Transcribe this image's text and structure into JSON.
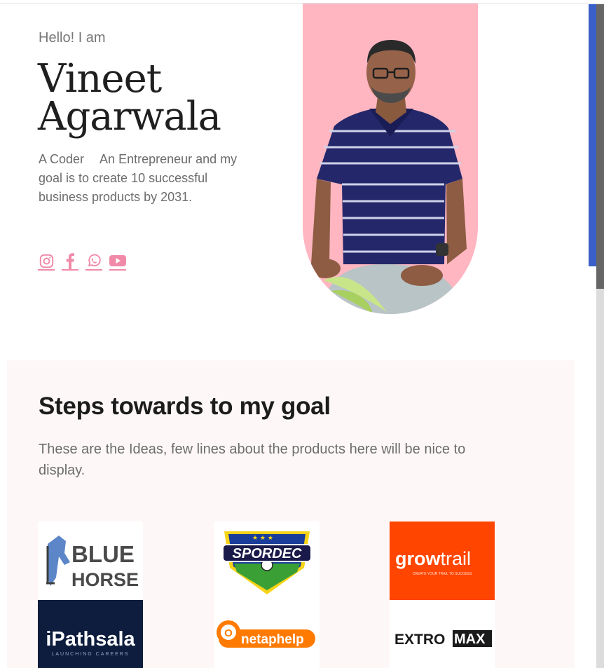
{
  "hero": {
    "greeting": "Hello! I am",
    "name_line1": "Vineet",
    "name_line2": "Agarwala",
    "role_1": "A Coder",
    "role_2": "An Entrepreneur",
    "goal_text": "and my goal is to create 10 successful business products by 2031.",
    "socials": [
      {
        "icon": "instagram-icon"
      },
      {
        "icon": "facebook-icon"
      },
      {
        "icon": "whatsapp-icon"
      },
      {
        "icon": "youtube-icon"
      }
    ],
    "portrait_bg": "#ffb6c1"
  },
  "goal_section": {
    "title": "Steps towards to my goal",
    "description": "These are the Ideas, few lines about the products here will be nice to display.",
    "logos": [
      {
        "name": "blue-horse-logo",
        "text_top": "BLUE",
        "text_bottom": "HORSE"
      },
      {
        "name": "spordec-logo",
        "text": "SPORDEC"
      },
      {
        "name": "growtrail-logo",
        "text_bold": "grow",
        "text_light": "trail",
        "tagline": "CREATE YOUR TRAIL TO SUCCESS"
      },
      {
        "name": "ipathsala-logo",
        "text": "iPathsala",
        "tagline": "LAUNCHING CAREERS"
      },
      {
        "name": "onetaphelp-logo",
        "text_o": "O",
        "text_rest": "netaphelp"
      },
      {
        "name": "extromax-logo",
        "text_left": "EXTRO",
        "text_right": "MAX"
      }
    ]
  },
  "colors": {
    "accent_pink": "#f08aa8",
    "scrollbar_blue": "#3a5fc8",
    "growtrail_orange": "#ff4500",
    "ipathsala_navy": "#0e1d3d"
  }
}
